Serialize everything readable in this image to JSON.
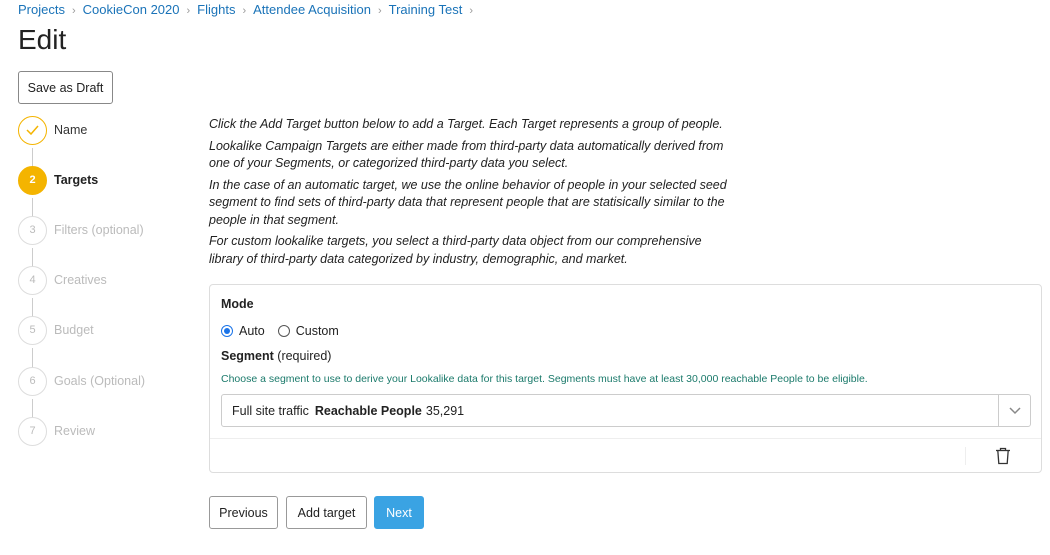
{
  "breadcrumb": [
    {
      "label": "Projects"
    },
    {
      "label": "CookieCon 2020"
    },
    {
      "label": "Flights"
    },
    {
      "label": "Attendee Acquisition"
    },
    {
      "label": "Training Test"
    }
  ],
  "breadcrumb_separator": "›",
  "page_title": "Edit",
  "save_draft_label": "Save as Draft",
  "steps": [
    {
      "number": "",
      "label": "Name",
      "state": "done",
      "icon": "check-icon"
    },
    {
      "number": "2",
      "label": "Targets",
      "state": "active"
    },
    {
      "number": "3",
      "label": "Filters (optional)",
      "state": "pending"
    },
    {
      "number": "4",
      "label": "Creatives",
      "state": "pending"
    },
    {
      "number": "5",
      "label": "Budget",
      "state": "pending"
    },
    {
      "number": "6",
      "label": "Goals (Optional)",
      "state": "pending"
    },
    {
      "number": "7",
      "label": "Review",
      "state": "pending"
    }
  ],
  "instructions": [
    "Click the Add Target button below to add a Target. Each Target represents a group of people.",
    "Lookalike Campaign Targets are either made from third-party data automatically derived from one of your Segments, or categorized third-party data you select.",
    "In the case of an automatic target, we use the online behavior of people in your selected seed segment to find sets of third-party data that represent people that are statisically similar to the people in that segment.",
    "For custom lookalike targets, you select a third-party data object from our comprehensive library of third-party data categorized by industry, demographic, and market."
  ],
  "target_card": {
    "mode_label": "Mode",
    "mode_options": [
      {
        "label": "Auto",
        "checked": true
      },
      {
        "label": "Custom",
        "checked": false
      }
    ],
    "segment_label": "Segment",
    "segment_required": "(required)",
    "segment_help": "Choose a segment to use to derive your Lookalike data for this target. Segments must have at least 30,000 reachable People to be eligible.",
    "segment_value": {
      "name": "Full site traffic",
      "reach_label": "Reachable People",
      "reach_count": "35,291"
    },
    "delete_icon": "trash-icon",
    "dropdown_icon": "chevron-down-icon"
  },
  "buttons": {
    "previous": "Previous",
    "add_target": "Add target",
    "next": "Next"
  },
  "colors": {
    "link": "#1a73b8",
    "step_accent": "#f4b400",
    "primary_button": "#3aa3e3",
    "help_text": "#1b7a6b",
    "radio_checked": "#1a73e8"
  }
}
